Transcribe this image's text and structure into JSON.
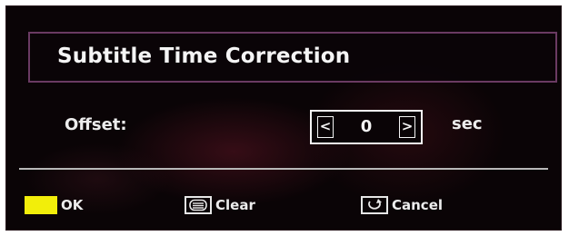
{
  "dialog": {
    "title": "Subtitle Time Correction"
  },
  "offset": {
    "label": "Offset:",
    "value": "0",
    "left_arrow": "<",
    "right_arrow": ">",
    "unit": "sec"
  },
  "footer": {
    "ok_label": "OK",
    "clear_label": "Clear",
    "cancel_label": "Cancel"
  },
  "icons": {
    "ok_key": "yellow-key-icon",
    "clear_key": "clear-key-icon",
    "cancel_key": "return-key-icon"
  },
  "colors": {
    "background": "#0a0406",
    "title_border": "#6a3a62",
    "yellow_key": "#f2ee0a",
    "text": "#f2f2f2"
  }
}
